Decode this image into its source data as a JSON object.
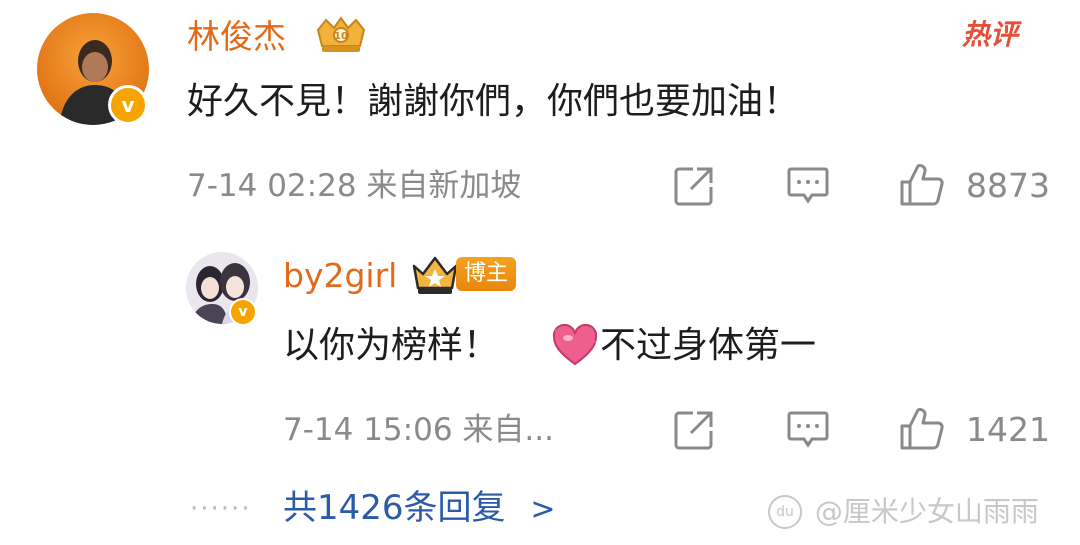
{
  "comment": {
    "author": "林俊杰",
    "hot_tag": "热评",
    "text": "好久不見！謝謝你們，你們也要加油！",
    "time_source": "7-14 02:28 来自新加坡",
    "likes": "8873",
    "icons": [
      "share-icon",
      "comment-icon",
      "like-icon"
    ]
  },
  "reply": {
    "author": "by2girl",
    "badge": "博主",
    "text_before_emoji": "以你为榜样！",
    "emoji": "heart-emoji",
    "text_after_emoji": "不过身体第一",
    "time_source": "7-14 15:06 来自...",
    "likes": "1421"
  },
  "more_replies": {
    "label": "共1426条回复",
    "arrow": ">"
  },
  "watermark": "@厘米少女山雨雨",
  "colors": {
    "name": "#e16a1b",
    "link": "#2b5aa8",
    "meta": "#8a8a8a",
    "verified": "#f7a300",
    "hot": "#e74e3a"
  }
}
